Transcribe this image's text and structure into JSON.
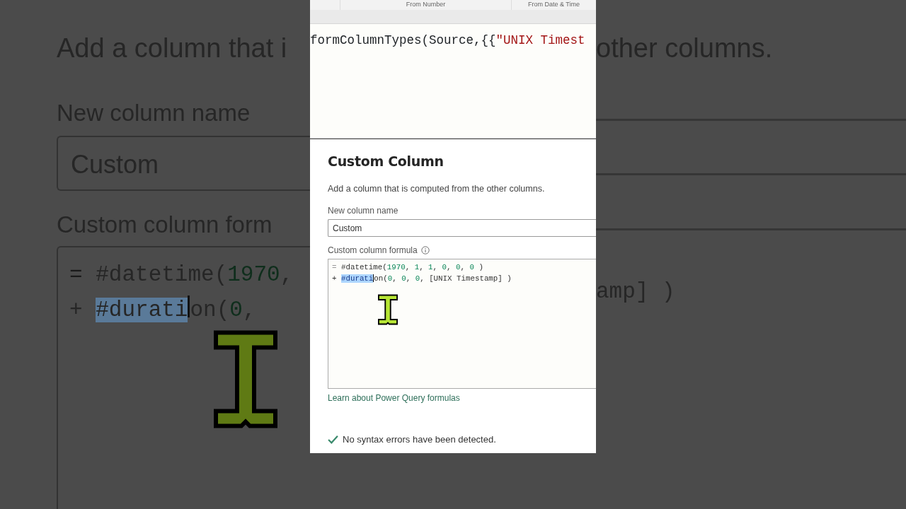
{
  "background_left": {
    "description": "Add a column that i",
    "name_label": "New column name",
    "name_value": "Custom",
    "formula_label": "Custom column form",
    "code_lines": [
      [
        {
          "text": "= ",
          "kind": "gutter"
        },
        {
          "text": "#datetime(",
          "kind": "plain"
        },
        {
          "text": "1970",
          "kind": "number"
        },
        {
          "text": ",",
          "kind": "plain"
        }
      ],
      [
        {
          "text": "+ ",
          "kind": "plain"
        },
        {
          "text": "#durati",
          "kind": "selected"
        },
        {
          "kind": "caret"
        },
        {
          "text": "on(",
          "kind": "plain"
        },
        {
          "text": "0",
          "kind": "number"
        },
        {
          "text": ",",
          "kind": "plain"
        }
      ]
    ]
  },
  "background_right": {
    "description": "other columns.",
    "code_lines": [
      [
        {
          "text": "amp] )",
          "kind": "plain"
        }
      ]
    ]
  },
  "grid_header": {
    "columns": [
      "From Number",
      "From Date & Time"
    ]
  },
  "formula_bar": {
    "segments": [
      {
        "text": "formColumnTypes(Source,{{",
        "kind": "plain"
      },
      {
        "text": "\"UNIX Timest",
        "kind": "string"
      }
    ]
  },
  "dialog": {
    "title": "Custom Column",
    "description": "Add a column that is computed from the other columns.",
    "name_label": "New column name",
    "name_value": "Custom",
    "formula_label": "Custom column formula",
    "code_lines": [
      [
        {
          "text": "= ",
          "kind": "gutter"
        },
        {
          "text": "#datetime(",
          "kind": "plain"
        },
        {
          "text": "1970",
          "kind": "number"
        },
        {
          "text": ", ",
          "kind": "plain"
        },
        {
          "text": "1",
          "kind": "number"
        },
        {
          "text": ", ",
          "kind": "plain"
        },
        {
          "text": "1",
          "kind": "number"
        },
        {
          "text": ", ",
          "kind": "plain"
        },
        {
          "text": "0",
          "kind": "number"
        },
        {
          "text": ", ",
          "kind": "plain"
        },
        {
          "text": "0",
          "kind": "number"
        },
        {
          "text": ", ",
          "kind": "plain"
        },
        {
          "text": "0",
          "kind": "number"
        },
        {
          "text": " )",
          "kind": "plain"
        }
      ],
      [
        {
          "text": "+ ",
          "kind": "plain"
        },
        {
          "text": "#durati",
          "kind": "selected"
        },
        {
          "kind": "caret"
        },
        {
          "text": "on(",
          "kind": "plain"
        },
        {
          "text": "0",
          "kind": "number"
        },
        {
          "text": ", ",
          "kind": "plain"
        },
        {
          "text": "0",
          "kind": "number"
        },
        {
          "text": ", ",
          "kind": "plain"
        },
        {
          "text": "0",
          "kind": "number"
        },
        {
          "text": ", [UNIX Timestamp] )",
          "kind": "plain"
        }
      ]
    ],
    "link": "Learn about Power Query formulas",
    "status": "No syntax errors have been detected."
  }
}
